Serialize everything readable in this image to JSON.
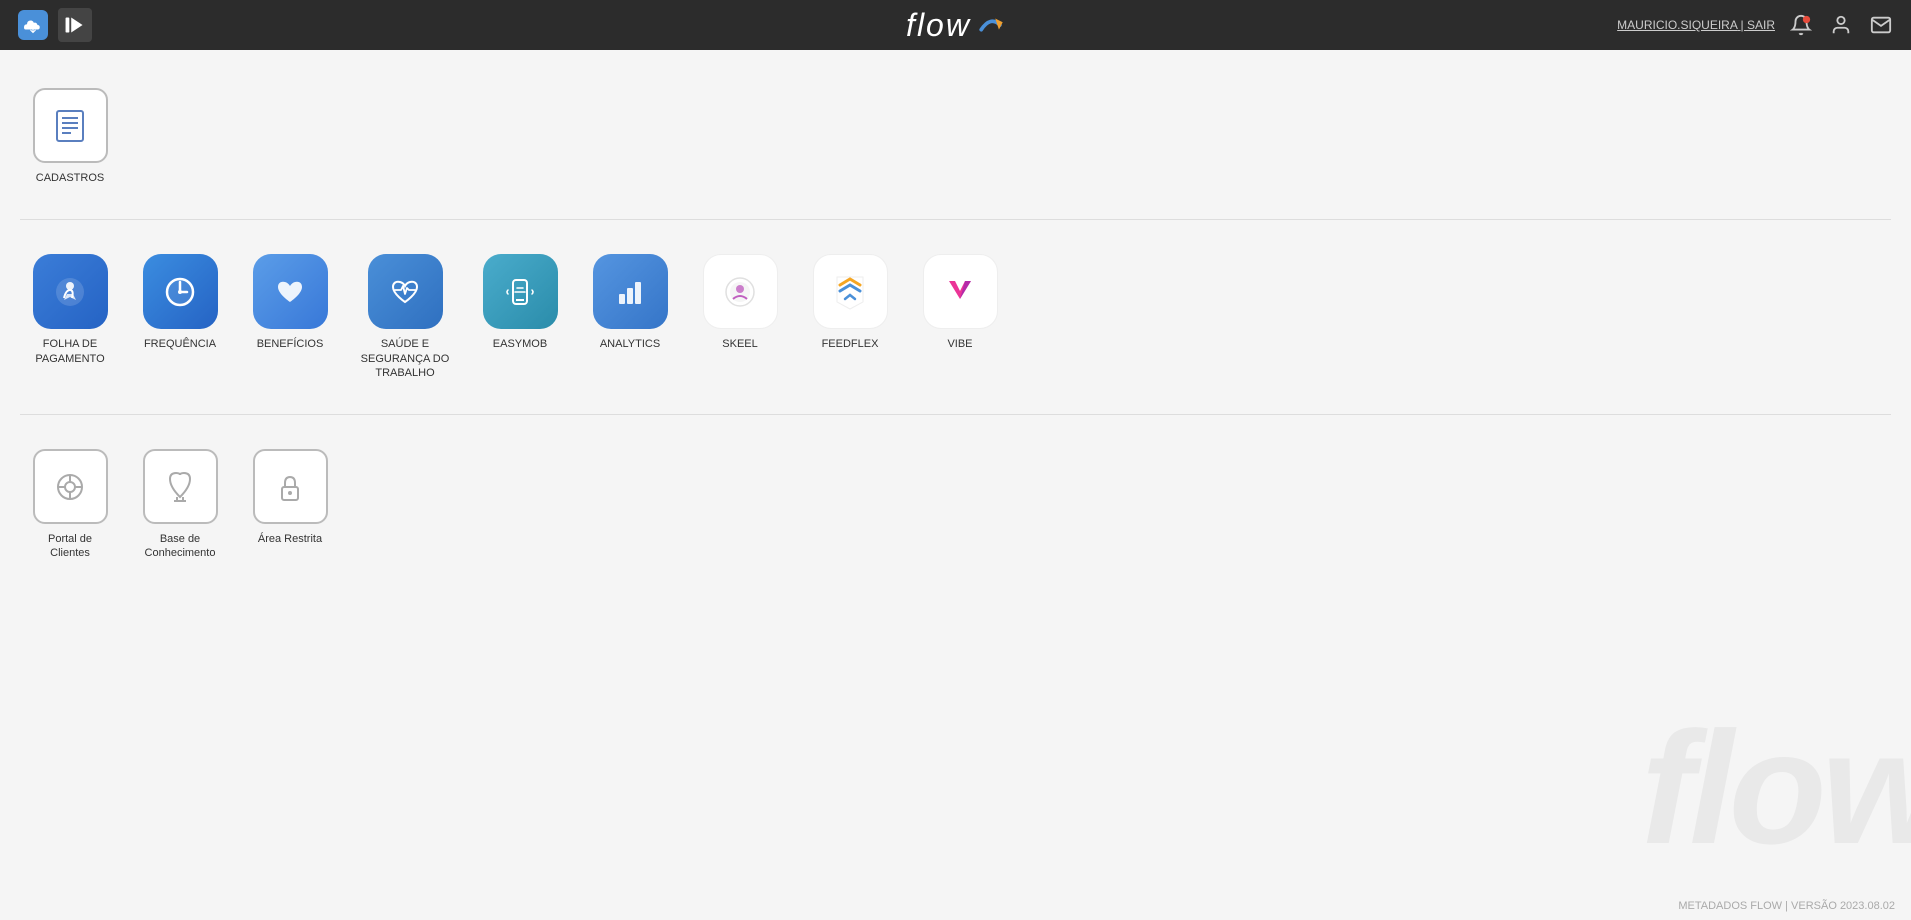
{
  "header": {
    "logo_text": "flow",
    "user_name": "MAURICIO.SIQUEIRA",
    "separator": "|",
    "logout_label": "SAIR"
  },
  "footer": {
    "text": "METADADOS FLOW | VERSÃO 2023.08.02"
  },
  "sections": [
    {
      "id": "cadastros",
      "apps": [
        {
          "id": "cadastros",
          "label": "CADASTROS",
          "type": "gray",
          "icon": "list"
        }
      ]
    },
    {
      "id": "main-apps",
      "apps": [
        {
          "id": "folha",
          "label": "FOLHA DE PAGAMENTO",
          "type": "colored",
          "bg": "bg-blue-folha",
          "icon": "hand-coin"
        },
        {
          "id": "frequencia",
          "label": "FREQUÊNCIA",
          "type": "colored",
          "bg": "bg-blue-freq",
          "icon": "clock"
        },
        {
          "id": "beneficios",
          "label": "BENEFÍCIOS",
          "type": "colored",
          "bg": "bg-blue-benef",
          "icon": "heart"
        },
        {
          "id": "saude",
          "label": "SAÚDE E SEGURANÇA DO TRABALHO",
          "type": "colored",
          "bg": "bg-blue-saude",
          "icon": "heartbeat"
        },
        {
          "id": "easymob",
          "label": "EASYMOB",
          "type": "colored",
          "bg": "bg-teal-easy",
          "icon": "mobile-signal"
        },
        {
          "id": "analytics",
          "label": "ANALYTICS",
          "type": "colored",
          "bg": "bg-blue-analytics",
          "icon": "bar-chart"
        },
        {
          "id": "skeel",
          "label": "SKEEL",
          "type": "white",
          "icon": "skeel"
        },
        {
          "id": "feedflex",
          "label": "FEEDFLEX",
          "type": "white",
          "icon": "feedflex"
        },
        {
          "id": "vibe",
          "label": "VIBE",
          "type": "white",
          "icon": "vibe"
        }
      ]
    },
    {
      "id": "other-apps",
      "apps": [
        {
          "id": "portal",
          "label": "Portal de Clientes",
          "type": "gray",
          "icon": "gear"
        },
        {
          "id": "base",
          "label": "Base de Conhecimento",
          "type": "gray",
          "icon": "graduation"
        },
        {
          "id": "restrita",
          "label": "Área Restrita",
          "type": "gray",
          "icon": "lock"
        }
      ]
    }
  ]
}
